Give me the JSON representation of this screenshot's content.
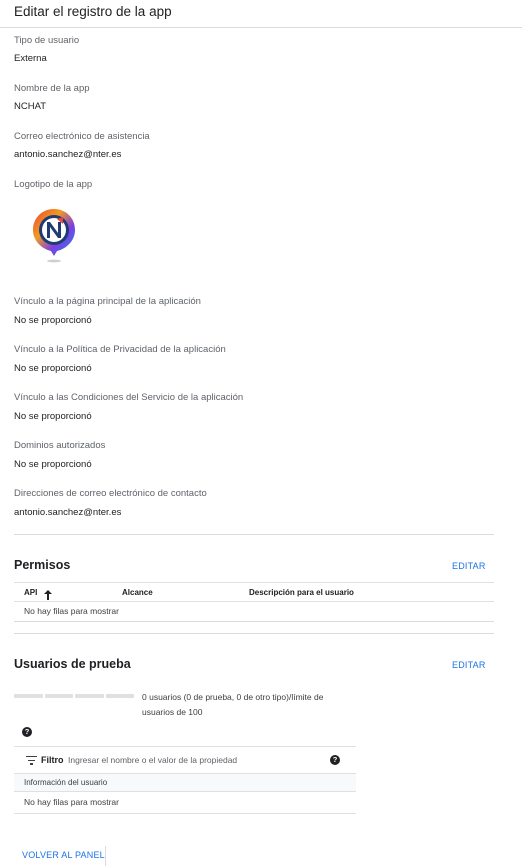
{
  "header": {
    "title": "Editar el registro de la app"
  },
  "fields": [
    {
      "label": "Tipo de usuario",
      "value": "Externa"
    },
    {
      "label": "Nombre de la app",
      "value": "NCHAT"
    },
    {
      "label": "Correo electrónico de asistencia",
      "value": "antonio.sanchez@nter.es"
    },
    {
      "label": "Logotipo de la app",
      "value": ""
    },
    {
      "label": "Vínculo a la página principal de la aplicación",
      "value": "No se proporcionó"
    },
    {
      "label": "Vínculo a la Política de Privacidad de la aplicación",
      "value": "No se proporcionó"
    },
    {
      "label": "Vínculo a las Condiciones del Servicio de la aplicación",
      "value": "No se proporcionó"
    },
    {
      "label": "Dominios autorizados",
      "value": "No se proporcionó"
    },
    {
      "label": "Direcciones de correo electrónico de contacto",
      "value": "antonio.sanchez@nter.es"
    }
  ],
  "logo": {
    "letter": "N",
    "icon": "app-logo-icon"
  },
  "permisos": {
    "title": "Permisos",
    "edit_label": "EDITAR",
    "columns": [
      "API",
      "Alcance",
      "Descripción para el usuario"
    ],
    "sort_icon": "arrow-up-icon",
    "empty_text": "No hay filas para mostrar"
  },
  "usuarios": {
    "title": "Usuarios de prueba",
    "edit_label": "EDITAR",
    "progress_fraction": 0,
    "progress_text_line1": "0 usuarios (0 de prueba, 0 de otro tipo)/límite de",
    "progress_text_line2": "usuarios de 100",
    "help_icon": "help-icon",
    "filter": {
      "label": "Filtro",
      "placeholder": "Ingresar el nombre o el valor de la propiedad",
      "value": "",
      "icon": "filter-icon"
    },
    "table_header": "Información del usuario",
    "empty_text": "No hay filas para mostrar"
  },
  "footer": {
    "back_label": "VOLVER AL PANEL"
  },
  "colors": {
    "link": "#1a73e8",
    "divider": "#dadce0",
    "text": "#202124",
    "muted": "#5f6368"
  }
}
